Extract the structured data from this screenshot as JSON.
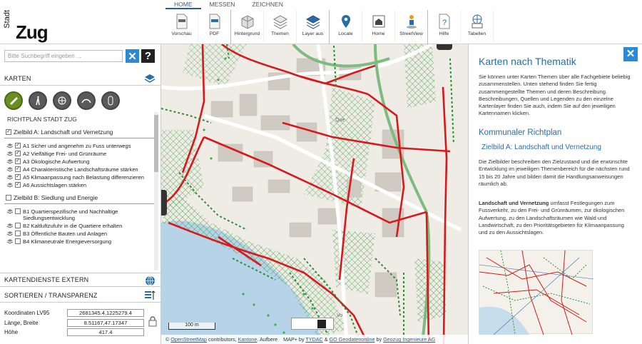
{
  "logo": {
    "small": "Stadt",
    "big": "Zug"
  },
  "tabs": [
    {
      "label": "HOME",
      "active": true
    },
    {
      "label": "MESSEN",
      "active": false
    },
    {
      "label": "ZEICHNEN",
      "active": false
    }
  ],
  "toolbar": [
    {
      "label": "Vorschau",
      "icon": "html-file-icon"
    },
    {
      "label": "PDF",
      "icon": "pdf-file-icon"
    },
    {
      "label": "Hintergrund",
      "icon": "background-icon"
    },
    {
      "label": "Themen",
      "icon": "layers-icon"
    },
    {
      "label": "Layer aus",
      "icon": "layers-off-icon"
    },
    {
      "label": "Locate",
      "icon": "locate-pin-icon"
    },
    {
      "label": "Home",
      "icon": "home-icon"
    },
    {
      "label": "StreetView",
      "icon": "streetview-icon"
    },
    {
      "label": "Hilfe",
      "icon": "help-icon"
    },
    {
      "label": "Tabellen",
      "icon": "tables-icon"
    }
  ],
  "search": {
    "placeholder": "Bitte Suchbegriff eingeben ..."
  },
  "left": {
    "karten_label": "KARTEN",
    "kartendienste_label": "KARTENDIENSTE EXTERN",
    "sortieren_label": "SORTIEREN / TRANSPARENZ",
    "tree_title": "RICHTPLAN STADT ZUG",
    "group_a": "Zielbild A: Landschaft und Vernetzung",
    "items_a": [
      "A1 Sicher und angenehm zu Fuss unterwegs",
      "A2 Vielfältige Frei- und Grünräume",
      "A3 Ökologische Aufwertung",
      "A4 Charakteristische Landschaftsräume stärken",
      "A5 Klimaanpassung nach Belastung differenzieren",
      "A6 Aussichtslagen stärken"
    ],
    "group_b": "Zielbild B: Siedlung und Energie",
    "items_b": [
      "B1 Quartierspezifische und Nachhaltige Siedlungsentwicklung",
      "B2 Kaltluftzufuhr in die Quartiere erhalten",
      "B3 Öffentliche Bauten und Anlagen",
      "B4 Klimaneutrale Energieversorgung"
    ]
  },
  "coords": {
    "lv95_label": "Koordinaten LV95",
    "lv95_value": "2681345.4,1225279.4",
    "lonlat_label": "Länge, Breite",
    "lonlat_value": "8.51167,47.17347",
    "height_label": "Höhe",
    "height_value": "417.4"
  },
  "map": {
    "scale": "100 m",
    "attribution_osm": "OpenStreetMap",
    "attribution_text1": " contributors, ",
    "attribution_kantone": "Kantone",
    "attribution_text2": ". Aufbere",
    "attribution_map": "MAP+ by ",
    "attribution_tydac": "TYDAC",
    "attribution_amp1": " & ",
    "attribution_geo": "GO Geodatenonline",
    "attribution_by": " by ",
    "attribution_geozug": "Geozug Ingenieure AG",
    "label_que": "Que",
    "label_vo": "Vo"
  },
  "right": {
    "title": "Karten nach Thematik",
    "intro": "Sie können unter Karten Themen über alle Fachgebiete beliebig zusammenstellen. Unten stehend finden Sie fertig zusammengestellte Themen und deren Beschreibung. Beschreibungen, Quellen und Legenden zu den einzelne Kartenlayer finden Sie auch, indem Sie auf den jeweiligen Kartennamen klicken.",
    "h2": "Kommunaler Richtplan",
    "h3": "Zielbild A: Landschaft und Vernetzung",
    "p1": "Die Zielbilder beschreiben den Zielzustand und die erwünschte Entwicklung im jeweiligen Themenbereich für die nächsten rund 15 bis 20 Jahre und bilden damit die Handlungsanweisungen räumlich ab.",
    "p2_bold": "Landschaft und Vernetzung",
    "p2": " umfasst Festlegungen zum Fussverkehr, zu den Frei- und Grünräumen, zur ökologischen Aufwertung, zu den Landschaftsräumen wie Wald und Landwirtschaft, zu den Prioritätsgebieten für Klimaanpassung und zu den Aussichtslagen."
  },
  "colors": {
    "accent": "#2a6ca8",
    "route_red": "#d7191c",
    "green_dash": "#2e8b3a"
  }
}
